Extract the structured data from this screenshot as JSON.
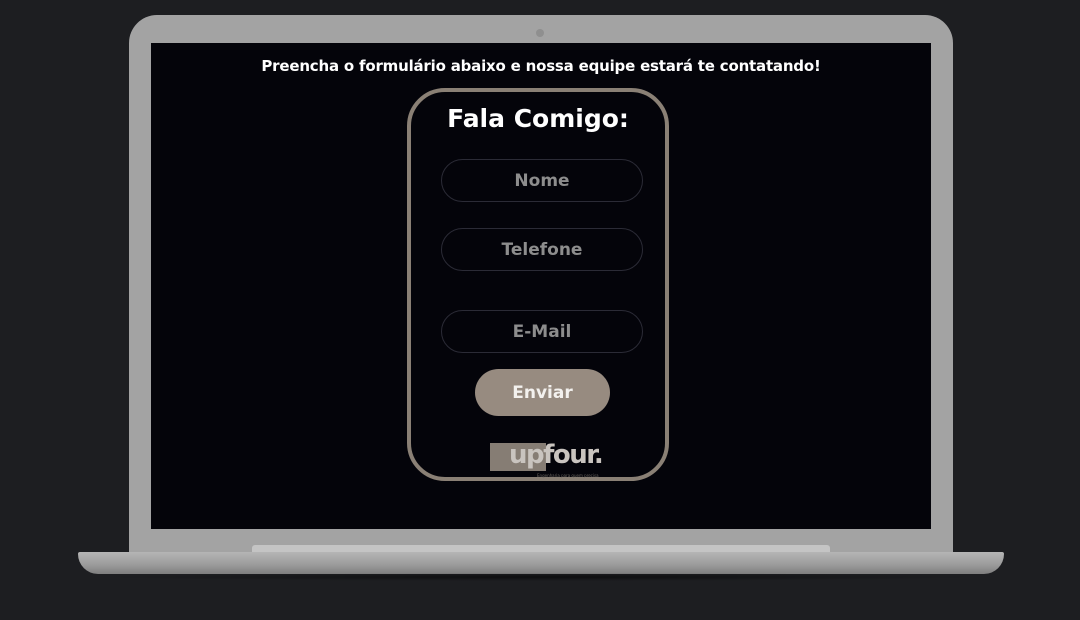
{
  "page": {
    "headline": "Preencha o formulário abaixo e  nossa equipe estará te contatando!"
  },
  "form": {
    "title": "Fala Comigo:",
    "name_placeholder": "Nome",
    "phone_placeholder": "Telefone",
    "email_placeholder": "E-Mail",
    "submit_label": "Enviar"
  },
  "logo": {
    "wordmark": "upfour.",
    "tagline": "Engenharia para quem precisa"
  },
  "colors": {
    "background": "#1d1e21",
    "screen": "#04040a",
    "accent": "#978b80",
    "card_border": "#8a8075",
    "laptop": "#a3a3a3"
  }
}
